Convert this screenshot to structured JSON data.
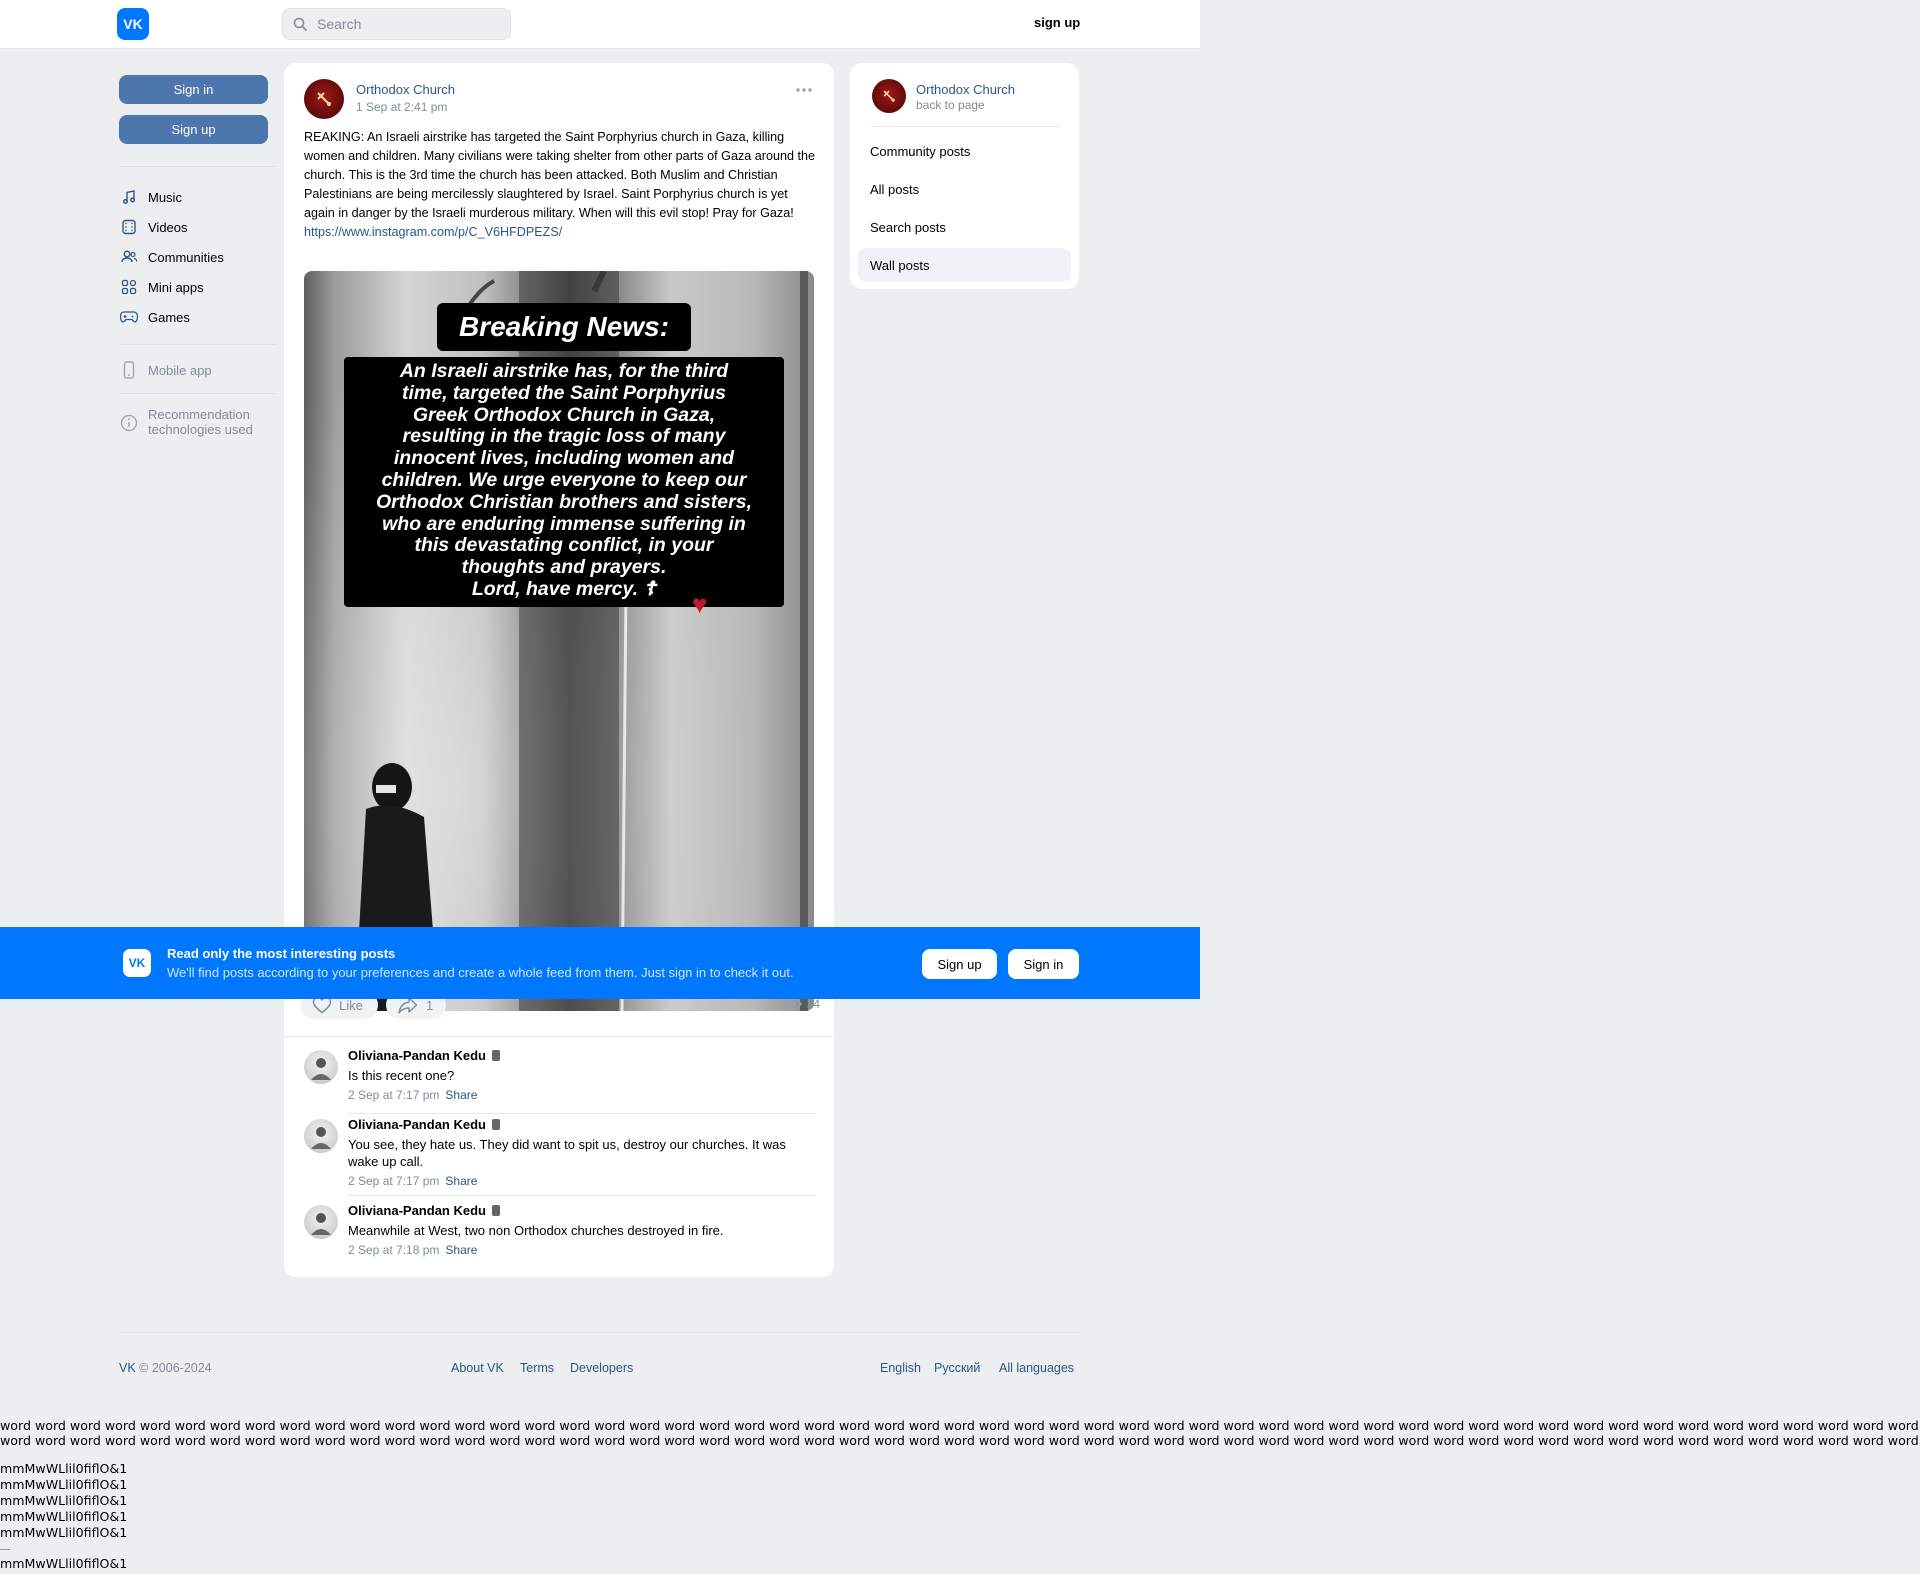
{
  "topbar": {
    "logo": "VK",
    "search_placeholder": "Search",
    "signup": "sign up"
  },
  "left_nav": {
    "signin_button": "Sign in",
    "signup_button": "Sign up",
    "items": [
      {
        "label": "Music",
        "icon": "music-note-icon"
      },
      {
        "label": "Videos",
        "icon": "video-icon"
      },
      {
        "label": "Communities",
        "icon": "users-icon"
      },
      {
        "label": "Mini apps",
        "icon": "grid-icon"
      },
      {
        "label": "Games",
        "icon": "gamepad-icon"
      }
    ],
    "mobile_app": "Mobile app",
    "recommendation_line1": "Recommendation",
    "recommendation_line2": "technologies used"
  },
  "post": {
    "author": "Orthodox Church",
    "date": "1 Sep at 2:41 pm",
    "text": "REAKING: An Israeli airstrike has targeted the Saint Porphyrius church in Gaza, killing women and children. Many civilians were taking shelter from other parts of Gaza around the church. This is the 3rd time the church has been attacked. Both Muslim and Christian Palestinians are being mercilessly slaughtered by Israel. Saint Porphyrius church is yet again in danger by the Israeli murderous military. When will this evil stop! Pray for Gaza!",
    "link": "https://www.instagram.com/p/C_V6HFDPEZS/",
    "media_heading": "Breaking News:",
    "media_lines": [
      "An Israeli airstrike has, for the third",
      "time, targeted the Saint Porphyrius",
      "Greek Orthodox Church in Gaza,",
      "resulting in the tragic loss of many",
      "innocent lives, including women and",
      "children. We urge everyone to keep our",
      "Orthodox Christian brothers and sisters,",
      "who are enduring immense suffering in",
      "this devastating conflict, in your",
      "thoughts and prayers.",
      "Lord, have mercy. ☦"
    ],
    "like_label": "Like",
    "share_count": "1",
    "views": "24"
  },
  "comments": [
    {
      "name": "Oliviana-Pandan Kedu",
      "text": "Is this recent one?",
      "time": "2 Sep at 7:17 pm",
      "share": "Share"
    },
    {
      "name": "Oliviana-Pandan Kedu",
      "text": "You see, they hate us. They did want to spit us, destroy our churches. It was wake up call.",
      "time": "2 Sep at 7:17 pm",
      "share": "Share"
    },
    {
      "name": "Oliviana-Pandan Kedu",
      "text": "Meanwhile at West, two non Orthodox churches destroyed in fire.",
      "time": "2 Sep at 7:18 pm",
      "share": "Share"
    }
  ],
  "right_panel": {
    "name": "Orthodox Church",
    "back": "back to page",
    "items": [
      "Community posts",
      "All posts",
      "Search posts",
      "Wall posts"
    ],
    "active_item": "Wall posts"
  },
  "banner": {
    "title": "Read only the most interesting posts",
    "subtitle": "We'll find posts according to your preferences and create a whole feed from them. Just sign in to check it out.",
    "signup": "Sign up",
    "signin": "Sign in"
  },
  "footer": {
    "copyright_brand": "VK",
    "copyright_rest": " © 2006-2024",
    "links": [
      "About VK",
      "Terms",
      "Developers"
    ],
    "languages": [
      "English",
      "Русский",
      "All languages"
    ]
  },
  "test_text": {
    "word_line": "word word word word word word word word word word word word word word word word word word word word word word word word word word word word word word word word word word word word word word word word word word word word word word word word word word word word word word word word word word word word word word word word word word word word word",
    "glyph_line": "mmMwWLlil0fiflO&1"
  },
  "colors": {
    "brand_blue": "#0077ff",
    "button_blue": "#4d77ac",
    "link": "#2a5885",
    "page_bg": "#edeef0"
  }
}
